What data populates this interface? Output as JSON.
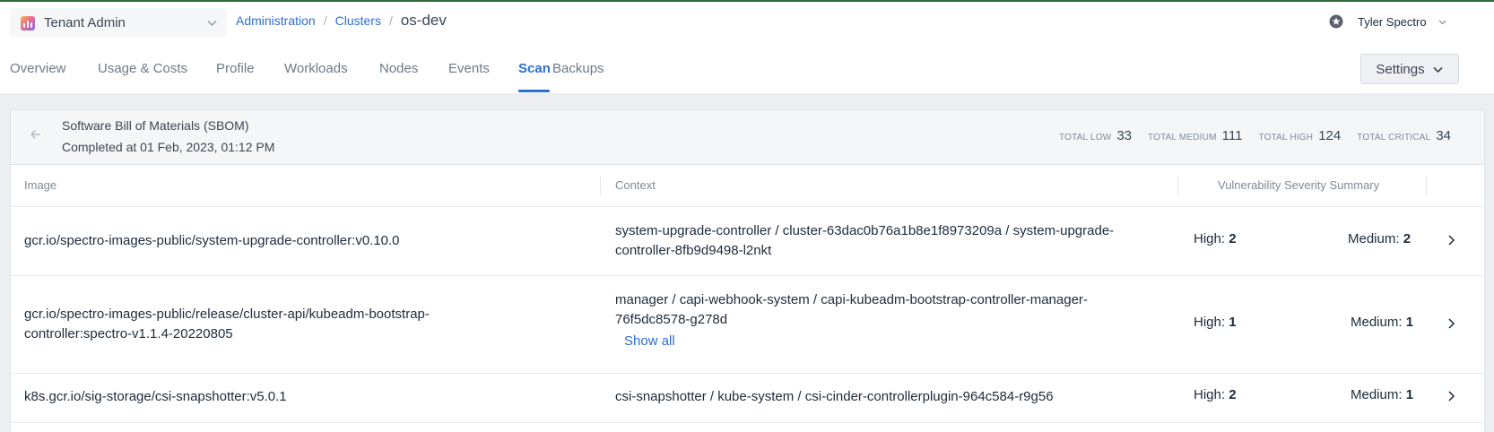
{
  "tenant": {
    "label": "Tenant Admin"
  },
  "breadcrumb": {
    "administration": "Administration",
    "clusters": "Clusters",
    "current": "os-dev"
  },
  "user": {
    "name": "Tyler Spectro"
  },
  "tabs": [
    {
      "label": "Overview"
    },
    {
      "label": "Usage & Costs"
    },
    {
      "label": "Profile"
    },
    {
      "label": "Workloads"
    },
    {
      "label": "Nodes"
    },
    {
      "label": "Events"
    },
    {
      "label": "Scan",
      "active": true
    },
    {
      "label": "Backups"
    }
  ],
  "settings": {
    "label": "Settings"
  },
  "sbom": {
    "title": "Software Bill of Materials (SBOM)",
    "completed": "Completed at 01 Feb, 2023, 01:12 PM",
    "totals": [
      {
        "label": "TOTAL LOW",
        "value": "33"
      },
      {
        "label": "TOTAL MEDIUM",
        "value": "111"
      },
      {
        "label": "TOTAL HIGH",
        "value": "124"
      },
      {
        "label": "TOTAL CRITICAL",
        "value": "34"
      }
    ]
  },
  "table": {
    "headers": {
      "image": "Image",
      "context": "Context",
      "severity": "Vulnerability Severity Summary"
    },
    "rows": [
      {
        "image": "gcr.io/spectro-images-public/system-upgrade-controller:v0.10.0",
        "context": "system-upgrade-controller / cluster-63dac0b76a1b8e1f8973209a / system-upgrade-controller-8fb9d9498-l2nkt",
        "high_label": "High:",
        "high": "2",
        "medium_label": "Medium:",
        "medium": "2"
      },
      {
        "image": "gcr.io/spectro-images-public/release/cluster-api/kubeadm-bootstrap-controller:spectro-v1.1.4-20220805",
        "context": "manager / capi-webhook-system / capi-kubeadm-bootstrap-controller-manager-76f5dc8578-g278d",
        "show_all": "Show all",
        "high_label": "High:",
        "high": "1",
        "medium_label": "Medium:",
        "medium": "1"
      },
      {
        "image": "k8s.gcr.io/sig-storage/csi-snapshotter:v5.0.1",
        "context": "csi-snapshotter / kube-system / csi-cinder-controllerplugin-964c584-r9g56",
        "high_label": "High:",
        "high": "2",
        "medium_label": "Medium:",
        "medium": "1"
      }
    ]
  },
  "icons": {
    "tenant": "tenant-logo-icon",
    "dropdown": "chevron-down-icon",
    "user": "user-star-icon",
    "back": "arrow-left-icon",
    "row": "chevron-right-icon"
  },
  "colors": {
    "accent": "#2d6fd0",
    "topline": "#2e6b3a",
    "text": "#1d2b3a",
    "muted": "#7f8a97"
  }
}
